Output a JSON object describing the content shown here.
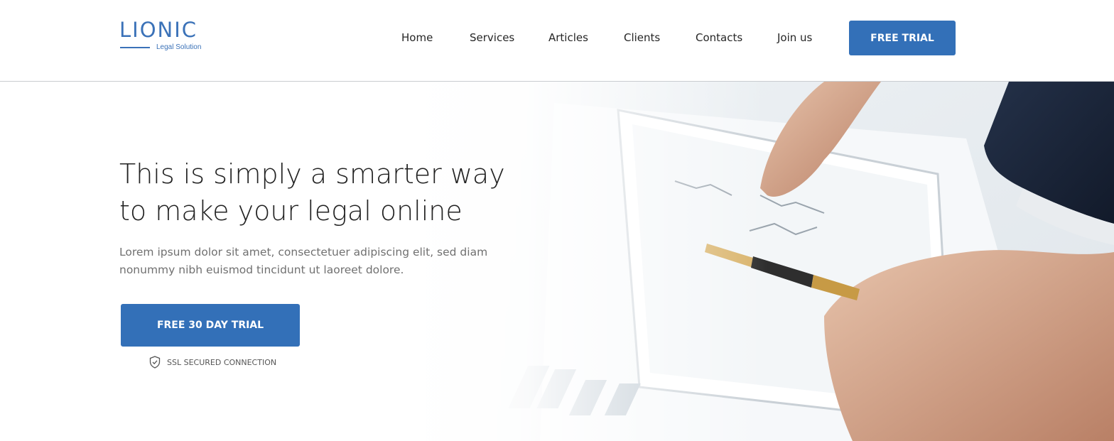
{
  "brand": {
    "name": "LIONIC",
    "tagline": "Legal Solution",
    "color": "#3b72b8"
  },
  "nav": {
    "items": [
      {
        "label": "Home"
      },
      {
        "label": "Services"
      },
      {
        "label": "Articles"
      },
      {
        "label": "Clients"
      },
      {
        "label": "Contacts"
      },
      {
        "label": "Join us"
      }
    ],
    "cta_label": "FREE TRIAL"
  },
  "hero": {
    "headline_line1": "This is simply a smarter way",
    "headline_line2": "to make your legal online",
    "lead": "Lorem ipsum dolor sit amet, consectetuer adipiscing elit, sed diam nonummy nibh euismod tincidunt ut laoreet dolore.",
    "cta_label": "FREE 30 DAY TRIAL",
    "ssl_icon": "shield-check-icon",
    "ssl_label": "SSL SECURED CONNECTION"
  },
  "colors": {
    "primary": "#3370b8",
    "text": "#222222",
    "muted": "#707070"
  }
}
